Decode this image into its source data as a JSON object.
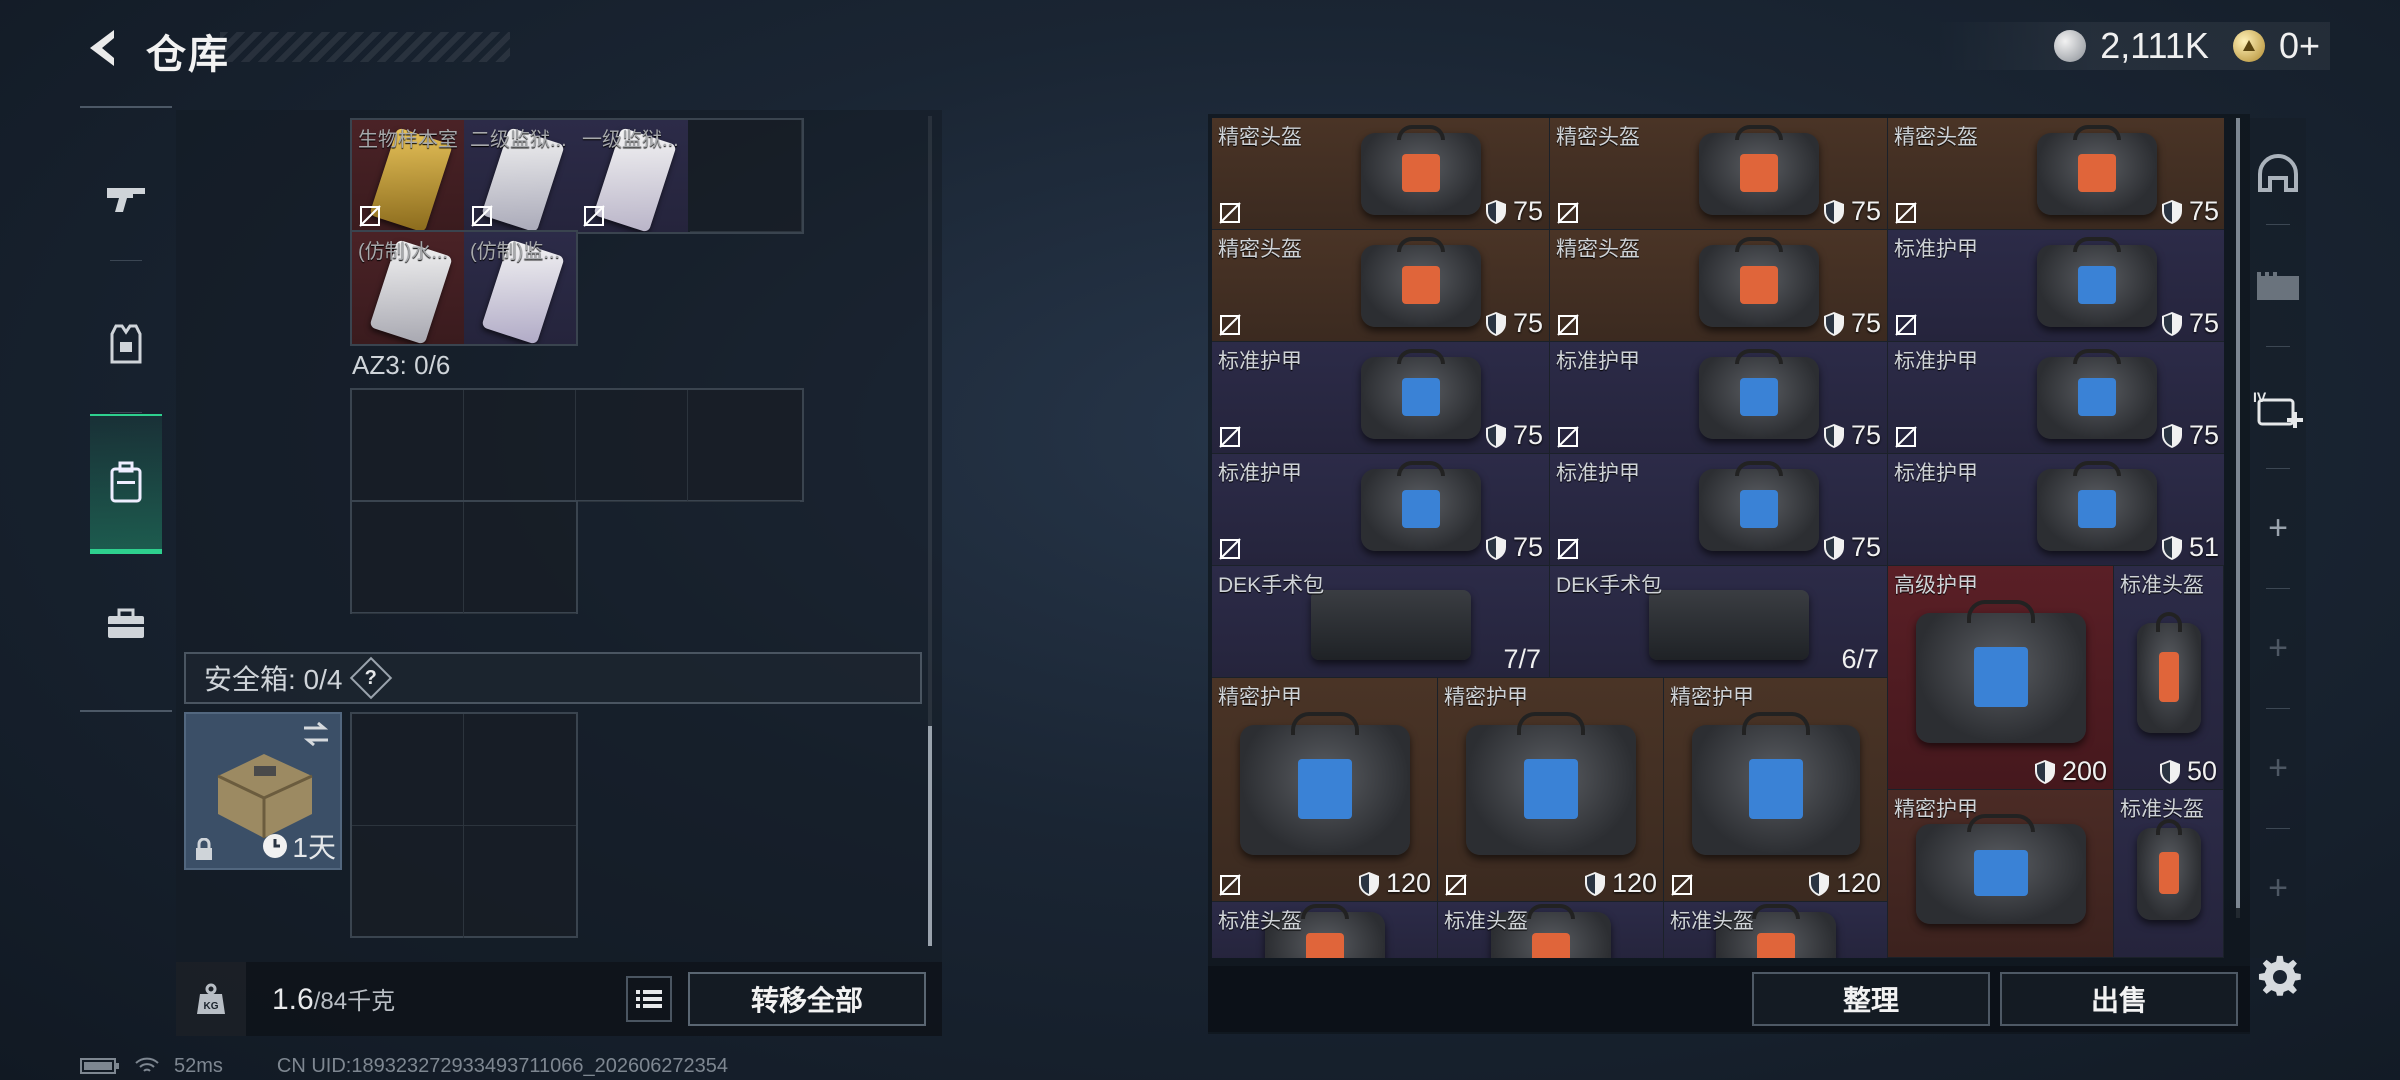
{
  "header": {
    "title": "仓库",
    "currency": [
      {
        "icon": "silver-coin-icon",
        "value": "2,111K"
      },
      {
        "icon": "gold-coin-icon",
        "value": "0+"
      }
    ]
  },
  "side_nav": {
    "items": [
      {
        "icon": "gun-icon",
        "active": false
      },
      {
        "icon": "armor-vest-icon",
        "active": false
      },
      {
        "icon": "backpack-icon",
        "active": true
      },
      {
        "icon": "toolbox-icon",
        "active": false
      }
    ]
  },
  "backpack": {
    "top_items": [
      {
        "name": "生物样本室",
        "rarity": "red"
      },
      {
        "name": "二级监狱...",
        "rarity": "purple"
      },
      {
        "name": "一级监狱...",
        "rarity": "purple"
      },
      {
        "name": "(仿制)水...",
        "rarity": "red"
      },
      {
        "name": "(仿制)监...",
        "rarity": "purple"
      }
    ],
    "az3_label": "AZ3: 0/6",
    "safebox_label": "安全箱: 0/4",
    "safebox_help": "?",
    "safebox_time": "1天"
  },
  "weight": {
    "current": "1.6",
    "max": "/84千克",
    "kg_icon": "kg-weight-icon"
  },
  "buttons": {
    "transfer_all": "转移全部",
    "sort": "整理",
    "sell": "出售"
  },
  "stash": {
    "items": [
      {
        "name": "精密头盔",
        "value": "75",
        "rarity": "brown",
        "kind": "helmet"
      },
      {
        "name": "精密头盔",
        "value": "75",
        "rarity": "brown",
        "kind": "helmet"
      },
      {
        "name": "精密头盔",
        "value": "75",
        "rarity": "brown",
        "kind": "helmet"
      },
      {
        "name": "精密头盔",
        "value": "75",
        "rarity": "brown",
        "kind": "helmet"
      },
      {
        "name": "精密头盔",
        "value": "75",
        "rarity": "brown",
        "kind": "helmet"
      },
      {
        "name": "标准护甲",
        "value": "75",
        "rarity": "purple",
        "kind": "armor"
      },
      {
        "name": "标准护甲",
        "value": "75",
        "rarity": "purple",
        "kind": "armor"
      },
      {
        "name": "标准护甲",
        "value": "75",
        "rarity": "purple",
        "kind": "armor"
      },
      {
        "name": "标准护甲",
        "value": "75",
        "rarity": "purple",
        "kind": "armor"
      },
      {
        "name": "标准护甲",
        "value": "75",
        "rarity": "purple",
        "kind": "armor"
      },
      {
        "name": "标准护甲",
        "value": "75",
        "rarity": "purple",
        "kind": "armor"
      },
      {
        "name": "标准护甲",
        "value": "51",
        "rarity": "purple",
        "kind": "armor"
      },
      {
        "name": "DEK手术包",
        "value": "7/7",
        "rarity": "purple",
        "kind": "kit"
      },
      {
        "name": "DEK手术包",
        "value": "6/7",
        "rarity": "purple",
        "kind": "kit"
      },
      {
        "name": "高级护甲",
        "value": "200",
        "rarity": "darkred",
        "kind": "armor-big"
      },
      {
        "name": "标准头盔",
        "value": "50",
        "rarity": "purple",
        "kind": "helmet-tall"
      },
      {
        "name": "精密护甲",
        "value": "120",
        "rarity": "brown",
        "kind": "armor-big"
      },
      {
        "name": "精密护甲",
        "value": "120",
        "rarity": "brown",
        "kind": "armor-big"
      },
      {
        "name": "精密护甲",
        "value": "120",
        "rarity": "brown",
        "kind": "armor-big"
      },
      {
        "name": "精密护甲",
        "value": "",
        "rarity": "brownred",
        "kind": "armor-big"
      },
      {
        "name": "标准头盔",
        "value": "",
        "rarity": "purple",
        "kind": "helmet-tall"
      },
      {
        "name": "标准头盔",
        "value": "",
        "rarity": "purple",
        "kind": "helmet"
      },
      {
        "name": "标准头盔",
        "value": "",
        "rarity": "purple",
        "kind": "helmet"
      },
      {
        "name": "标准头盔",
        "value": "",
        "rarity": "purple",
        "kind": "helmet"
      }
    ]
  },
  "right_nav": {
    "items": [
      "helmet-slot-icon",
      "rig-slot-icon",
      "add-storage-icon",
      "plus-icon",
      "plus-icon",
      "plus-icon",
      "plus-icon"
    ]
  },
  "status": {
    "ping": "52ms",
    "uid": "CN UID:1893232729334937110​66_202606272354"
  },
  "colors": {
    "accent": "#2ed08e",
    "rarity_red": "#4a2226",
    "rarity_brown": "#4a3426",
    "rarity_purple": "#2c2b48"
  }
}
